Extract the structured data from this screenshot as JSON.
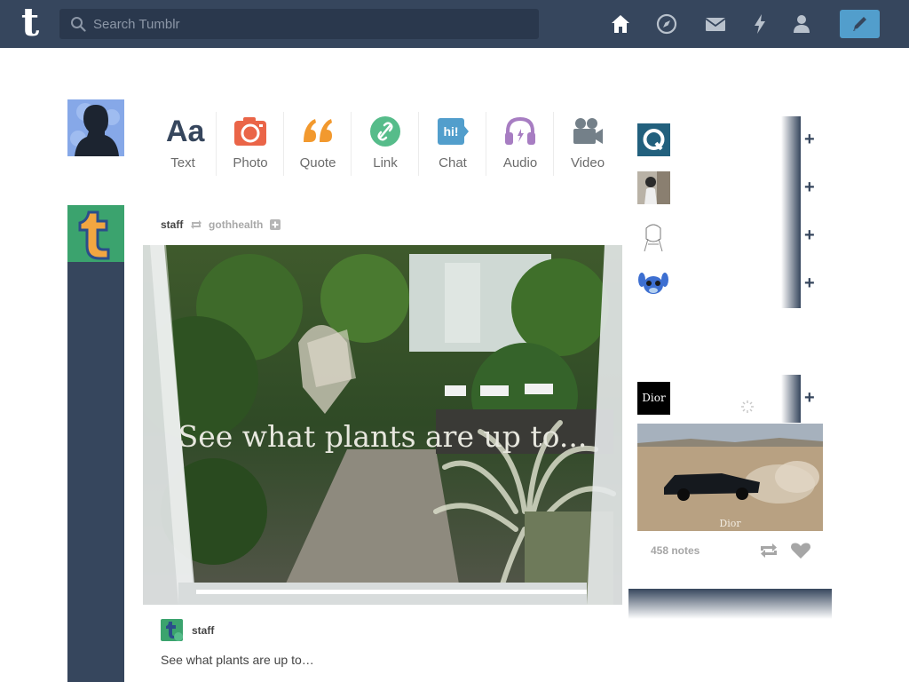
{
  "header": {
    "logo": "t",
    "search_placeholder": "Search Tumblr"
  },
  "post_types": [
    {
      "label": "Text",
      "icon": "text-icon",
      "color": "#36465d"
    },
    {
      "label": "Photo",
      "icon": "camera-icon",
      "color": "#ea6548"
    },
    {
      "label": "Quote",
      "icon": "quote-icon",
      "color": "#f2992e"
    },
    {
      "label": "Link",
      "icon": "link-icon",
      "color": "#56bc8a"
    },
    {
      "label": "Chat",
      "icon": "chat-icon",
      "color": "#529ecc"
    },
    {
      "label": "Audio",
      "icon": "headphones-icon",
      "color": "#a77dc2"
    },
    {
      "label": "Video",
      "icon": "video-camera-icon",
      "color": "#748089"
    }
  ],
  "post": {
    "author": "staff",
    "reblogged_from": "gothhealth",
    "image_caption": "See what plants are up to...",
    "footer_author": "staff",
    "text": "See what plants are up to…"
  },
  "sidebar": {
    "recommended": [
      {
        "icon": "q-logo-avatar"
      },
      {
        "icon": "person-photo-avatar"
      },
      {
        "icon": "sketch-avatar"
      },
      {
        "icon": "stitch-avatar"
      }
    ],
    "sponsored": {
      "avatar_text": "Dior",
      "image_watermark": "Dior",
      "notes": "458 notes"
    }
  },
  "colors": {
    "nav": "#36465d",
    "search_bg": "#2a384d",
    "compose": "#529ecc",
    "staff_green": "#3ba36e"
  }
}
